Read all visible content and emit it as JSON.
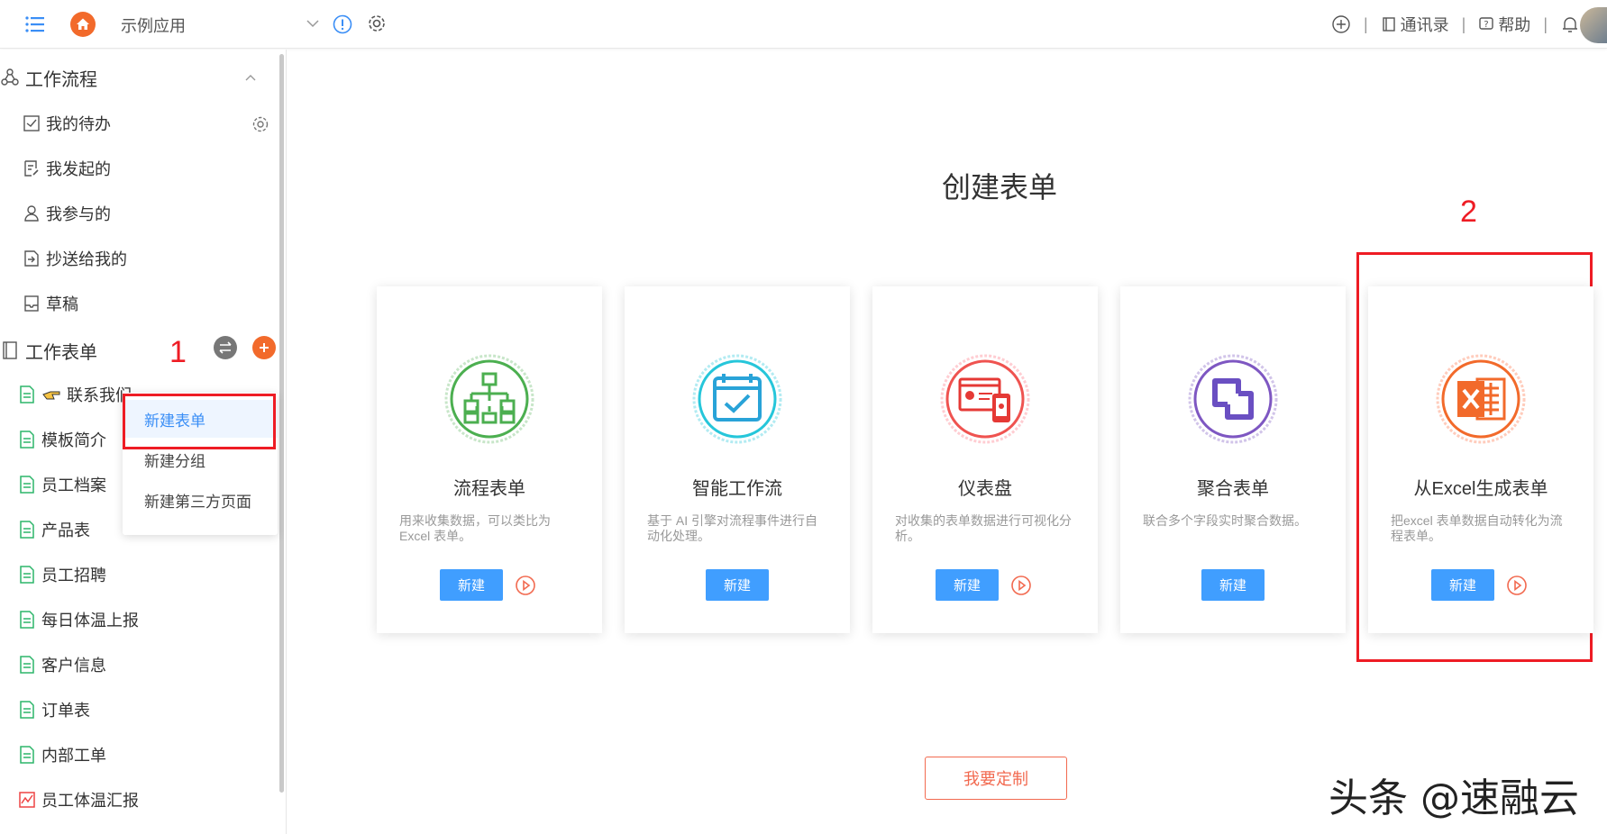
{
  "header": {
    "app_name": "示例应用",
    "right_items": [
      {
        "label": "通讯录",
        "icon": "contacts-icon"
      },
      {
        "label": "帮助",
        "icon": "help-icon"
      }
    ]
  },
  "sidebar": {
    "workflow": {
      "title": "工作流程",
      "items": [
        "我的待办",
        "我发起的",
        "我参与的",
        "抄送给我的",
        "草稿"
      ]
    },
    "forms": {
      "title": "工作表单",
      "items": [
        "联系我们",
        "模板简介",
        "员工档案",
        "产品表",
        "员工招聘",
        "每日体温上报",
        "客户信息",
        "订单表",
        "内部工单",
        "员工体温汇报"
      ]
    }
  },
  "dropdown": {
    "items": [
      "新建表单",
      "新建分组",
      "新建第三方页面"
    ]
  },
  "annotations": {
    "label1": "1",
    "label2": "2"
  },
  "main": {
    "title": "创建表单",
    "cards": [
      {
        "title": "流程表单",
        "desc": "用来收集数据，可以类比为Excel 表单。",
        "button": "新建",
        "color": "#4caf50",
        "has_play": true
      },
      {
        "title": "智能工作流",
        "desc": "基于 AI 引擎对流程事件进行自动化处理。",
        "button": "新建",
        "color": "#26c6da",
        "has_play": false
      },
      {
        "title": "仪表盘",
        "desc": "对收集的表单数据进行可视化分析。",
        "button": "新建",
        "color": "#ef5350",
        "has_play": true
      },
      {
        "title": "聚合表单",
        "desc": "联合多个字段实时聚合数据。",
        "button": "新建",
        "color": "#7e57c2",
        "has_play": false
      },
      {
        "title": "从Excel生成表单",
        "desc": "把excel 表单数据自动转化为流程表单。",
        "button": "新建",
        "color": "#f26a2b",
        "has_play": true
      }
    ],
    "custom_button": "我要定制"
  },
  "watermark": "头条 @速融云",
  "colors": {
    "accent": "#409eff",
    "brand_orange": "#f26a2b",
    "annotation_red": "#ee1c24"
  }
}
